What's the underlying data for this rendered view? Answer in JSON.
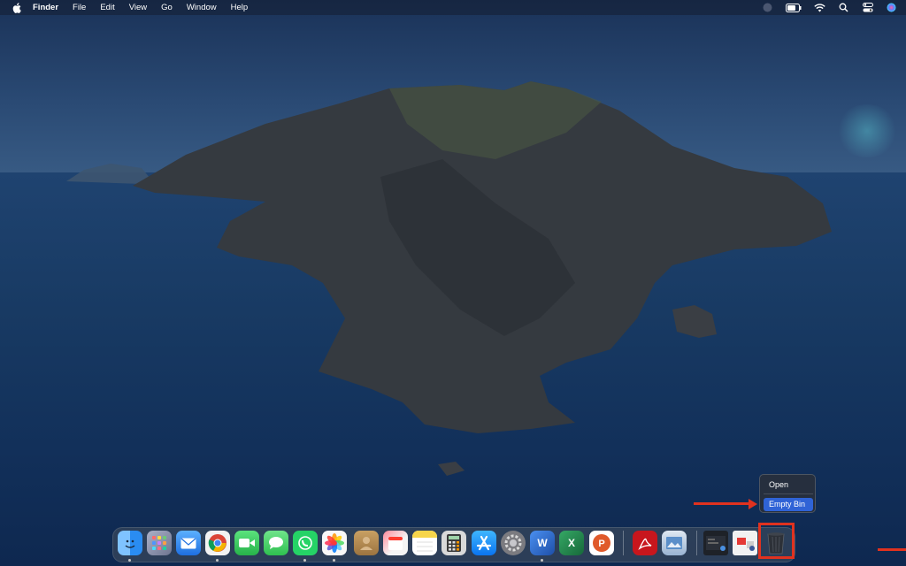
{
  "menubar": {
    "apple_icon": "apple-logo-icon",
    "items": [
      "Finder",
      "File",
      "Edit",
      "View",
      "Go",
      "Window",
      "Help"
    ],
    "status_icons": [
      "siri-dot-icon",
      "battery-icon",
      "wifi-icon",
      "search-icon",
      "control-center-icon",
      "siri-icon"
    ]
  },
  "context_menu": {
    "open_label": "Open",
    "empty_bin_label": "Empty Bin"
  },
  "dock": {
    "apps": [
      {
        "name": "finder-icon",
        "glyph": "☺",
        "color": "#2a8cf2"
      },
      {
        "name": "launchpad-icon",
        "glyph": "▦",
        "color": "#8a8fa8"
      },
      {
        "name": "mail-icon",
        "glyph": "✉",
        "color": "#2f7de8"
      },
      {
        "name": "chrome-icon",
        "glyph": "◉",
        "color": "#e8e8e8"
      },
      {
        "name": "facetime-icon",
        "glyph": "▶",
        "color": "#33c45a"
      },
      {
        "name": "messages-icon",
        "glyph": "◯",
        "color": "#35c759"
      },
      {
        "name": "whatsapp-icon",
        "glyph": "✆",
        "color": "#25d366"
      },
      {
        "name": "photos-icon",
        "glyph": "✿",
        "color": "#f0f0f0"
      },
      {
        "name": "contacts-icon",
        "glyph": "☻",
        "color": "#b3894d"
      },
      {
        "name": "calendar-icon",
        "glyph": "▭",
        "color": "#f5f5f5"
      },
      {
        "name": "notes-icon",
        "glyph": "≡",
        "color": "#f7d54a"
      },
      {
        "name": "calculator-icon",
        "glyph": "▤",
        "color": "#d7d7d7"
      },
      {
        "name": "app-store-icon",
        "glyph": "A",
        "color": "#1e8ef7"
      },
      {
        "name": "system-preferences-icon",
        "glyph": "⚙",
        "color": "#8e8e93"
      },
      {
        "name": "word-icon",
        "glyph": "W",
        "color": "#2b5fbf"
      },
      {
        "name": "excel-icon",
        "glyph": "X",
        "color": "#1f7a46"
      },
      {
        "name": "powerpoint-icon",
        "glyph": "P",
        "color": "#d14a24"
      },
      {
        "name": "acrobat-icon",
        "glyph": "A",
        "color": "#c8161d"
      },
      {
        "name": "preview-icon",
        "glyph": "▣",
        "color": "#a8c4e0"
      },
      {
        "name": "recent-item-1-icon",
        "glyph": "▪",
        "color": "#222831"
      },
      {
        "name": "recent-item-2-icon",
        "glyph": "▫",
        "color": "#f0f0f0"
      },
      {
        "name": "bin-icon",
        "glyph": "▥",
        "color": "#3a3f47"
      }
    ],
    "running_dots": [
      "finder",
      "chrome",
      "whatsapp",
      "photos",
      "word"
    ]
  },
  "colors": {
    "annotation": "#e0321f",
    "menu_highlight": "#2f63d6"
  }
}
